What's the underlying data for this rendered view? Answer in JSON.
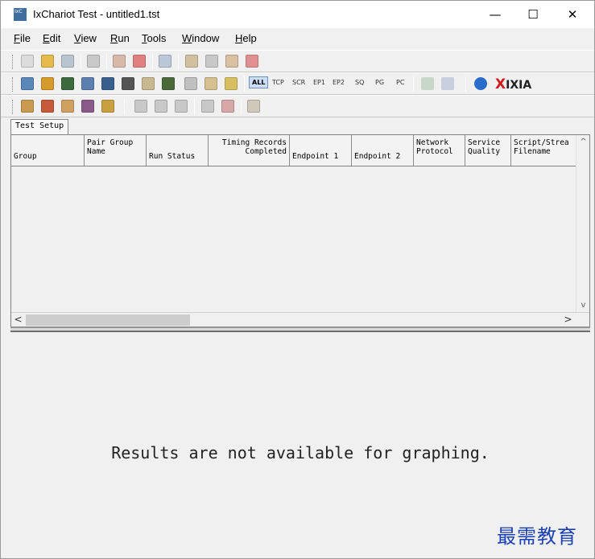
{
  "window": {
    "title": "IxChariot Test - untitled1.tst",
    "icon_text": "IxC",
    "controls": {
      "minimize": "—",
      "maximize": "☐",
      "close": "✕"
    }
  },
  "menu": {
    "items": [
      {
        "label_u": "F",
        "label_rest": "ile"
      },
      {
        "label_u": "E",
        "label_rest": "dit"
      },
      {
        "label_u": "V",
        "label_rest": "iew"
      },
      {
        "label_u": "R",
        "label_rest": "un"
      },
      {
        "label_u": "T",
        "label_rest": "ools"
      },
      {
        "label_u": "W",
        "label_rest": "indow"
      },
      {
        "label_u": "H",
        "label_rest": "elp"
      }
    ]
  },
  "toolbar1": {
    "icons": [
      "new-file-icon",
      "open-folder-icon",
      "save-icon",
      "print-icon",
      "run-icon",
      "stop-icon",
      "refresh-icon",
      "add-pair-icon",
      "copy-icon",
      "edit-icon",
      "delete-icon"
    ],
    "colors": [
      "#dcdcdc",
      "#e5b94a",
      "#b8c4d0",
      "#c9c9c9",
      "#d8b8a8",
      "#e08080",
      "#b9c7d9",
      "#d0c0a0",
      "#c8c8c8",
      "#d8c0a0",
      "#e09090"
    ]
  },
  "toolbar2": {
    "icons": [
      "pair-icon",
      "multicast-pair-icon",
      "endpoint-icon",
      "network-icon",
      "group-icon",
      "keyboard-icon",
      "script-icon",
      "edit-script-icon",
      "graph-icon",
      "export-icon",
      "filter-icon"
    ],
    "colors": [
      "#5a86b8",
      "#d49a2c",
      "#3d6a3d",
      "#5c7fb0",
      "#3a5f8f",
      "#555555",
      "#c8b890",
      "#4a6a3a",
      "#c0c0c0",
      "#d6c090",
      "#d8c060"
    ],
    "protocols": [
      "ALL",
      "TCP",
      "SCR",
      "EP1",
      "EP2",
      "SQ",
      "PG",
      "PC"
    ],
    "active_protocol": "ALL",
    "extra_icons": [
      "view-icon",
      "window-icon",
      "info-icon"
    ],
    "brand": {
      "x": "X",
      "text": "IXIA"
    }
  },
  "toolbar3": {
    "icons": [
      "hand-icon",
      "pin-icon",
      "tools-icon",
      "wizard-icon",
      "palette-icon",
      "compare-icon",
      "swap-icon",
      "check-icon",
      "expand-icon",
      "collapse-icon",
      "chart-icon"
    ],
    "colors": [
      "#c79a4f",
      "#c65a3a",
      "#d0a060",
      "#8a5a8a",
      "#c8a040",
      "#c8c8c8",
      "#c8c8c8",
      "#c8c8c8",
      "#c8c8c8",
      "#d8a8a8",
      "#d0c8b8"
    ]
  },
  "tabs": [
    {
      "label": "Test Setup"
    }
  ],
  "table": {
    "columns": [
      {
        "line1": "",
        "line2": "Group"
      },
      {
        "line1": "Pair Group",
        "line2": "Name"
      },
      {
        "line1": "",
        "line2": "Run Status"
      },
      {
        "line1": "Timing Records",
        "line2": "Completed"
      },
      {
        "line1": "",
        "line2": "Endpoint 1"
      },
      {
        "line1": "",
        "line2": "Endpoint 2"
      },
      {
        "line1": "Network",
        "line2": "Protocol"
      },
      {
        "line1": "Service",
        "line2": "Quality"
      },
      {
        "line1": "Script/Strea",
        "line2": "Filename"
      }
    ],
    "rows": [],
    "scroll": {
      "up": "^",
      "down": "v",
      "left": "<",
      "right": ">"
    }
  },
  "graph": {
    "message": "Results are not available for graphing."
  },
  "watermark": "最需教育"
}
